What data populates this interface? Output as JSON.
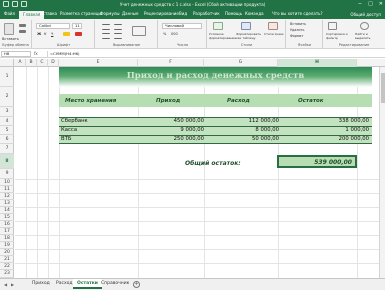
{
  "window": {
    "title": "Учет денежных средств с 1 с.xlsx - Excel (Сбой активации продукта)",
    "controls": [
      "−",
      "□",
      "✕"
    ]
  },
  "menu": {
    "tabs": [
      "Файл",
      "Главная",
      "Вставка",
      "Разметка страницы",
      "Формулы",
      "Данные",
      "Рецензирование",
      "Вид",
      "Разработчик",
      "Помощь",
      "Команда"
    ],
    "active": "Главная",
    "tell_me": "Что вы хотите сделать?",
    "share": "Общий доступ"
  },
  "ribbon": {
    "groups": [
      "Буфер обмена",
      "Шрифт",
      "Выравнивание",
      "Число",
      "Стили",
      "Ячейки",
      "Редактирование"
    ],
    "paste_label": "Вставить",
    "font_name": "Calibri",
    "font_size": "11",
    "number_format": "Числовой",
    "cond_format": "Условное форматирование",
    "format_table": "Форматировать как таблицу",
    "cell_styles": "Стили ячеек",
    "insert": "Вставить",
    "delete": "Удалить",
    "format": "Формат",
    "sort": "Сортировка и фильтр",
    "find": "Найти и выделить"
  },
  "formula_bar": {
    "name_box": "H8",
    "fx": "fx",
    "formula": "=СУММ(H4:H6)"
  },
  "columns": [
    "A",
    "B",
    "C",
    "D",
    "E",
    "F",
    "G",
    "H"
  ],
  "rows": [
    "1",
    "2",
    "3",
    "4",
    "5",
    "6",
    "7",
    "8",
    "9",
    "10",
    "11",
    "12",
    "13",
    "14",
    "15",
    "16",
    "17",
    "18",
    "19",
    "20",
    "21",
    "22",
    "23",
    "24",
    "25"
  ],
  "sheet": {
    "title": "Приход и расход денежных средств",
    "headers": {
      "place": "Место хранения",
      "income": "Приход",
      "expense": "Расход",
      "balance": "Остаток"
    },
    "rows": [
      {
        "place": "Сбербанк",
        "income": "450 000,00",
        "expense": "112 000,00",
        "balance": "338 000,00"
      },
      {
        "place": "Касса",
        "income": "9 000,00",
        "expense": "8 000,00",
        "balance": "1 000,00"
      },
      {
        "place": "ВТБ",
        "income": "250 000,00",
        "expense": "50 000,00",
        "balance": "200 000,00"
      }
    ],
    "total_label": "Общий остаток:",
    "total_value": "539 000,00"
  },
  "sheet_tabs": {
    "tabs": [
      "Приход",
      "Расход",
      "Остатки",
      "Справочник"
    ],
    "active": "Остатки",
    "add": "+"
  },
  "colors": {
    "excel_green": "#217346",
    "table_fill": "#c3e2bf",
    "header_fill": "#b7ddb3"
  }
}
